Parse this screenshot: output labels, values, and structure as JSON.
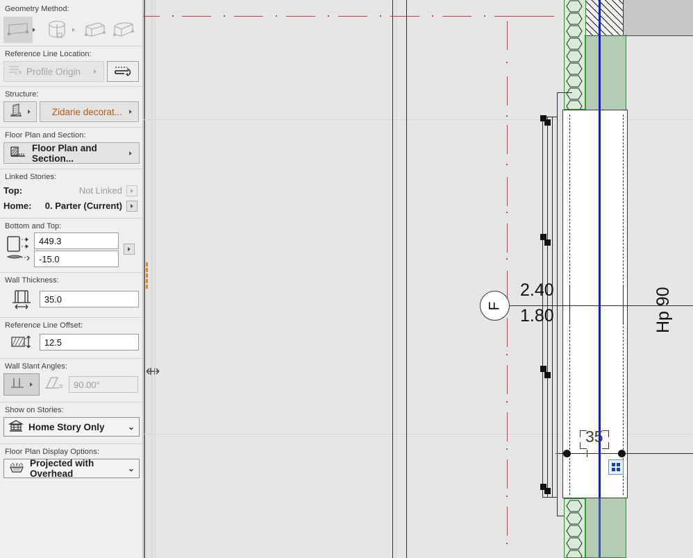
{
  "sidebar": {
    "sections": [
      {
        "label": "Geometry Method:",
        "options": [
          "straight-wall-icon",
          "curved-wall-icon",
          "rectangle-wall-icon",
          "trapezoid-wall-icon"
        ],
        "selected_index": 0
      },
      {
        "label": "Reference Line Location:",
        "value": "Profile Origin",
        "flip_icon": "flip-reference-line-icon"
      },
      {
        "label": "Structure:",
        "structure_icon": "composite-structure-icon",
        "value": "Zidarie decorat...",
        "value_color": "#b35a12"
      },
      {
        "label": "Floor Plan and Section:",
        "value": "Floor Plan and Section...",
        "icon": "floor-plan-section-icon"
      },
      {
        "label": "Linked Stories:",
        "rows": [
          {
            "key": "Top:",
            "value": "Not Linked",
            "enabled": false
          },
          {
            "key": "Home:",
            "value": "0. Parter (Current)",
            "enabled": true
          }
        ]
      },
      {
        "label": "Bottom and Top:",
        "top_value": "449.3",
        "bottom_value": "-15.0",
        "icon": "bottom-top-icon"
      },
      {
        "label": "Wall Thickness:",
        "value": "35.0",
        "icon": "wall-thickness-icon"
      },
      {
        "label": "Reference Line Offset:",
        "value": "12.5",
        "icon": "reference-offset-icon"
      },
      {
        "label": "Wall Slant Angles:",
        "mode_icon": "vertical-wall-icon",
        "angle_icon": "slant-angle-icon",
        "angle_value": "90.00°"
      },
      {
        "label": "Show on Stories:",
        "value": "Home Story Only",
        "icon": "stories-icon"
      },
      {
        "label": "Floor Plan Display Options:",
        "value": "Projected with Overhead",
        "icon": "projected-overhead-icon"
      }
    ]
  },
  "canvas": {
    "marker_label": "F",
    "dimension_above": "2.40",
    "dimension_below": "1.80",
    "vertical_label": "Hp 90",
    "thickness_dimension": "35",
    "tracker_icon": "tracker-grid-icon",
    "colors": {
      "reference_line": "#1417e8",
      "wall_fill_green": "#6eaa6e",
      "wall_outline_green": "#1a9c1a",
      "centerline_red": "#cf3b3b",
      "canvas_background": "#e6e6e6"
    }
  }
}
